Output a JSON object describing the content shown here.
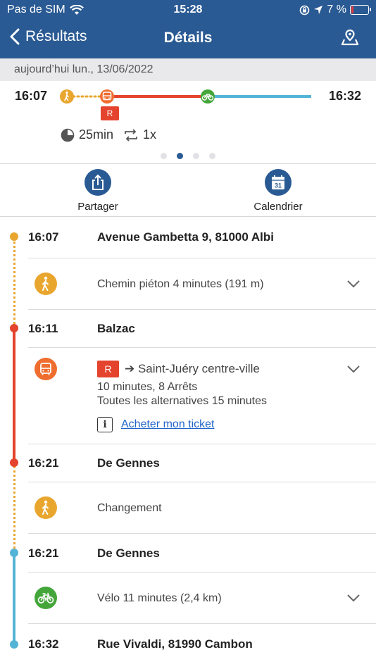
{
  "status_bar": {
    "carrier": "Pas de SIM",
    "time": "15:28",
    "battery": "7 %"
  },
  "nav": {
    "back_label": "Résultats",
    "title": "Détails"
  },
  "date": "aujourd’hui lun., 13/06/2022",
  "summary": {
    "departure": "16:07",
    "arrival": "16:32",
    "route_badge": "R",
    "duration": "25min",
    "transfers": "1x",
    "page_count": 4,
    "active_page": 2
  },
  "actions": {
    "share_label": "Partager",
    "calendar_label": "Calendrier",
    "calendar_day": "31"
  },
  "itinerary": {
    "stops": [
      {
        "time": "16:07",
        "name": "Avenue Gambetta 9, 81000 Albi"
      },
      {
        "time": "16:11",
        "name": "Balzac"
      },
      {
        "time": "16:21",
        "name": "De Gennes"
      },
      {
        "time": "16:21",
        "name": "De Gennes"
      },
      {
        "time": "16:32",
        "name": "Rue Vivaldi, 81990 Cambon"
      }
    ],
    "legs": {
      "walk1": "Chemin piéton 4 minutes (191 m)",
      "bus": {
        "route": "R",
        "destination": "➔ Saint-Juéry centre-ville",
        "line1": "10 minutes, 8 Arrêts",
        "line2": "Toutes les alternatives 15 minutes",
        "ticket_link": "Acheter mon ticket"
      },
      "transfer": "Changement",
      "bike": "Vélo 11 minutes (2,4 km)"
    }
  },
  "colors": {
    "primary": "#2a5a93",
    "walk": "#e9a62f",
    "bus": "#e4432d",
    "bus_icon": "#ef6d2e",
    "bike_line": "#54b4d6",
    "bike_icon": "#44a63a",
    "link": "#2165c9"
  }
}
